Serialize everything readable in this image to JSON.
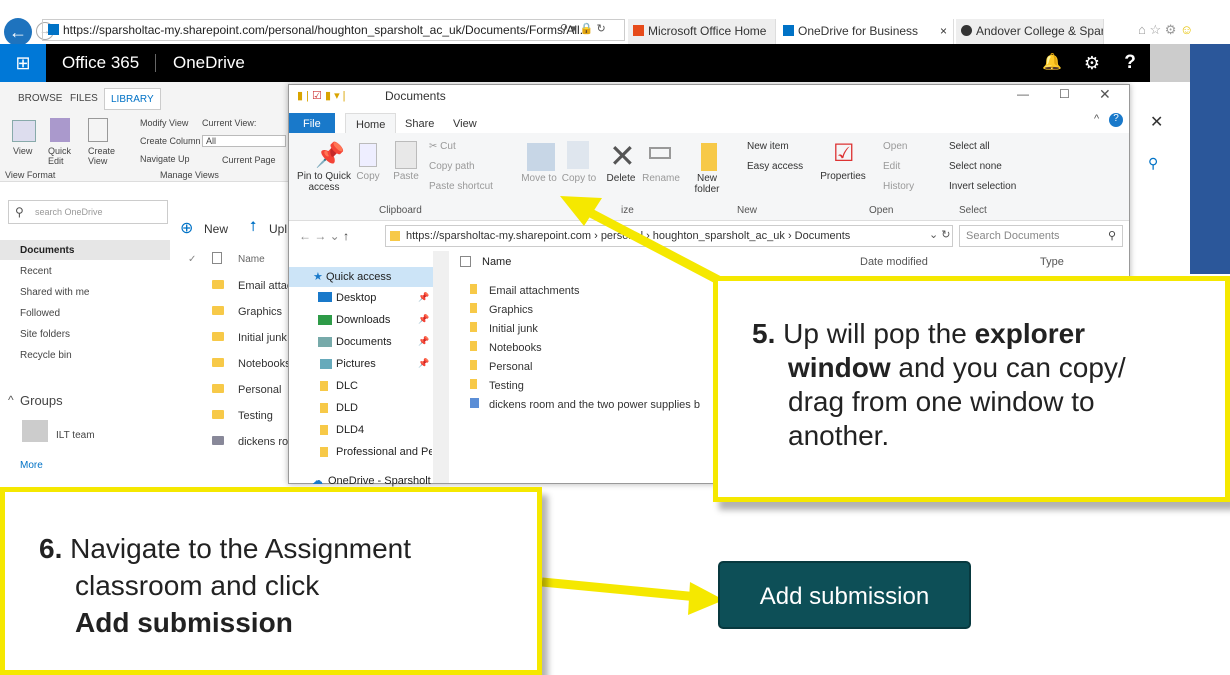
{
  "browser": {
    "url": "https://sparsholtac-my.sharepoint.com/personal/houghton_sparsholt_ac_uk/Documents/Forms/All...",
    "tabs": [
      "Microsoft Office Home",
      "OneDrive for Business",
      "Andover College & Spars..."
    ],
    "tab_close": "×"
  },
  "o365": {
    "brand": "Office 365",
    "app": "OneDrive",
    "help": "?"
  },
  "sharepoint": {
    "tabs": [
      "BROWSE",
      "FILES",
      "LIBRARY"
    ],
    "view_label": "View",
    "quick_edit": "Quick Edit",
    "create_view": "Create View",
    "modify_view": "Modify View",
    "create_column": "Create Column",
    "navigate_up": "Navigate Up",
    "current_view_label": "Current View:",
    "current_view_value": "All",
    "current_page": "Current Page",
    "view_format": "View Format",
    "manage_views": "Manage Views",
    "search_placeholder": "search OneDrive",
    "nav": [
      "Documents",
      "Recent",
      "Shared with me",
      "Followed",
      "Site folders",
      "Recycle bin"
    ],
    "groups_label": "Groups",
    "group_item": "ILT team",
    "more": "More",
    "new_btn": "New",
    "upload_btn": "Upl",
    "name_col": "Name",
    "files": [
      "Email attac",
      "Graphics",
      "Initial junk",
      "Notebooks",
      "Personal",
      "Testing",
      "dickens roo"
    ]
  },
  "explorer": {
    "title": "Documents",
    "ribbon_tabs": [
      "File",
      "Home",
      "Share",
      "View"
    ],
    "buttons": {
      "pin": "Pin to Quick access",
      "copy": "Copy",
      "paste": "Paste",
      "cut": "Cut",
      "copy_path": "Copy path",
      "paste_shortcut": "Paste shortcut",
      "move_to": "Move to",
      "copy_to": "Copy to",
      "delete": "Delete",
      "rename": "Rename",
      "new_folder": "New folder",
      "new_item": "New item",
      "easy_access": "Easy access",
      "properties": "Properties",
      "open": "Open",
      "edit": "Edit",
      "history": "History",
      "select_all": "Select all",
      "select_none": "Select none",
      "invert_selection": "Invert selection"
    },
    "groups": [
      "Clipboard",
      "ize",
      "New",
      "Open",
      "Select"
    ],
    "address": "https://sparsholtac-my.sharepoint.com › personal › houghton_sparsholt_ac_uk › Documents",
    "search_placeholder": "Search Documents",
    "quick_access": [
      "Quick access",
      "Desktop",
      "Downloads",
      "Documents",
      "Pictures",
      "DLC",
      "DLD",
      "DLD4",
      "Professional and Per",
      "OneDrive - Sparsholt"
    ],
    "columns": [
      "Name",
      "Date modified",
      "Type"
    ],
    "files": [
      "Email attachments",
      "Graphics",
      "Initial junk",
      "Notebooks",
      "Personal",
      "Testing",
      "dickens room and the two power supplies b"
    ]
  },
  "callout5": {
    "num": "5.",
    "t1": "Up will pop the ",
    "b1": "explorer",
    "b2": "window",
    "t2": " and you can copy/",
    "t3": "drag from one window to",
    "t4": "another."
  },
  "callout6": {
    "num": "6.",
    "t1": "Navigate to the Assignment",
    "t2": "classroom and click",
    "b1": "Add submission"
  },
  "add_submission": "Add submission",
  "colors": {
    "highlight": "#f5e800",
    "button": "#0d4f57",
    "o365": "#000000",
    "accent": "#0078d7"
  }
}
